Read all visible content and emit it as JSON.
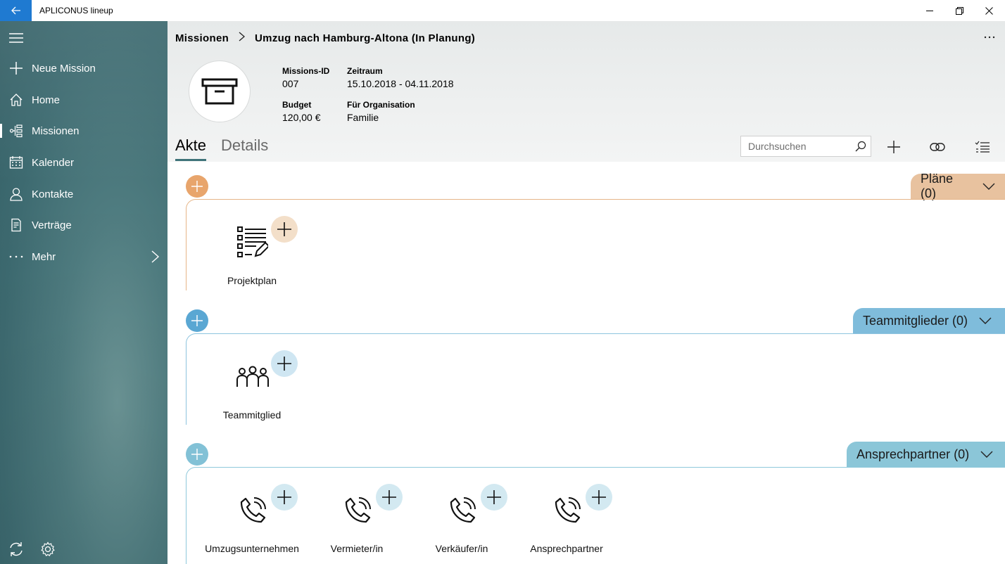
{
  "app": {
    "title": "APLICONUS lineup"
  },
  "sidebar": {
    "items": [
      {
        "label": "Neue Mission",
        "icon": "plus-icon"
      },
      {
        "label": "Home",
        "icon": "home-icon"
      },
      {
        "label": "Missionen",
        "icon": "missions-icon"
      },
      {
        "label": "Kalender",
        "icon": "calendar-icon"
      },
      {
        "label": "Kontakte",
        "icon": "contacts-icon"
      },
      {
        "label": "Verträge",
        "icon": "contracts-icon"
      },
      {
        "label": "Mehr",
        "icon": "more-icon"
      }
    ]
  },
  "breadcrumb": {
    "root": "Missionen",
    "current": "Umzug nach Hamburg-Altona (In Planung)"
  },
  "mission": {
    "id_label": "Missions-ID",
    "id_value": "007",
    "period_label": "Zeitraum",
    "period_value": "15.10.2018 - 04.11.2018",
    "budget_label": "Budget",
    "budget_value": "120,00 €",
    "org_label": "Für Organisation",
    "org_value": "Familie"
  },
  "tabs": [
    {
      "label": "Akte"
    },
    {
      "label": "Details"
    }
  ],
  "search": {
    "placeholder": "Durchsuchen"
  },
  "sections": [
    {
      "title": "Pläne (0)",
      "color": "#e8c09c",
      "accent": "#e6a96f",
      "tiles": [
        {
          "label": "Projektplan",
          "icon": "project-plan-icon"
        }
      ]
    },
    {
      "title": "Teammitglieder (0)",
      "color": "#7fbcdb",
      "accent": "#5aa7d3",
      "tiles": [
        {
          "label": "Teammitglied",
          "icon": "team-icon"
        }
      ]
    },
    {
      "title": "Ansprechpartner (0)",
      "color": "#8bc6d8",
      "accent": "#82c1d6",
      "tiles": [
        {
          "label": "Umzugsunternehmen",
          "icon": "phone-icon"
        },
        {
          "label": "Vermieter/in",
          "icon": "phone-icon"
        },
        {
          "label": "Verkäufer/in",
          "icon": "phone-icon"
        },
        {
          "label": "Ansprechpartner",
          "icon": "phone-icon"
        }
      ]
    }
  ],
  "colors": {
    "titlebar_back": "#1f7ad1",
    "tab_underline": "#3f7379"
  }
}
